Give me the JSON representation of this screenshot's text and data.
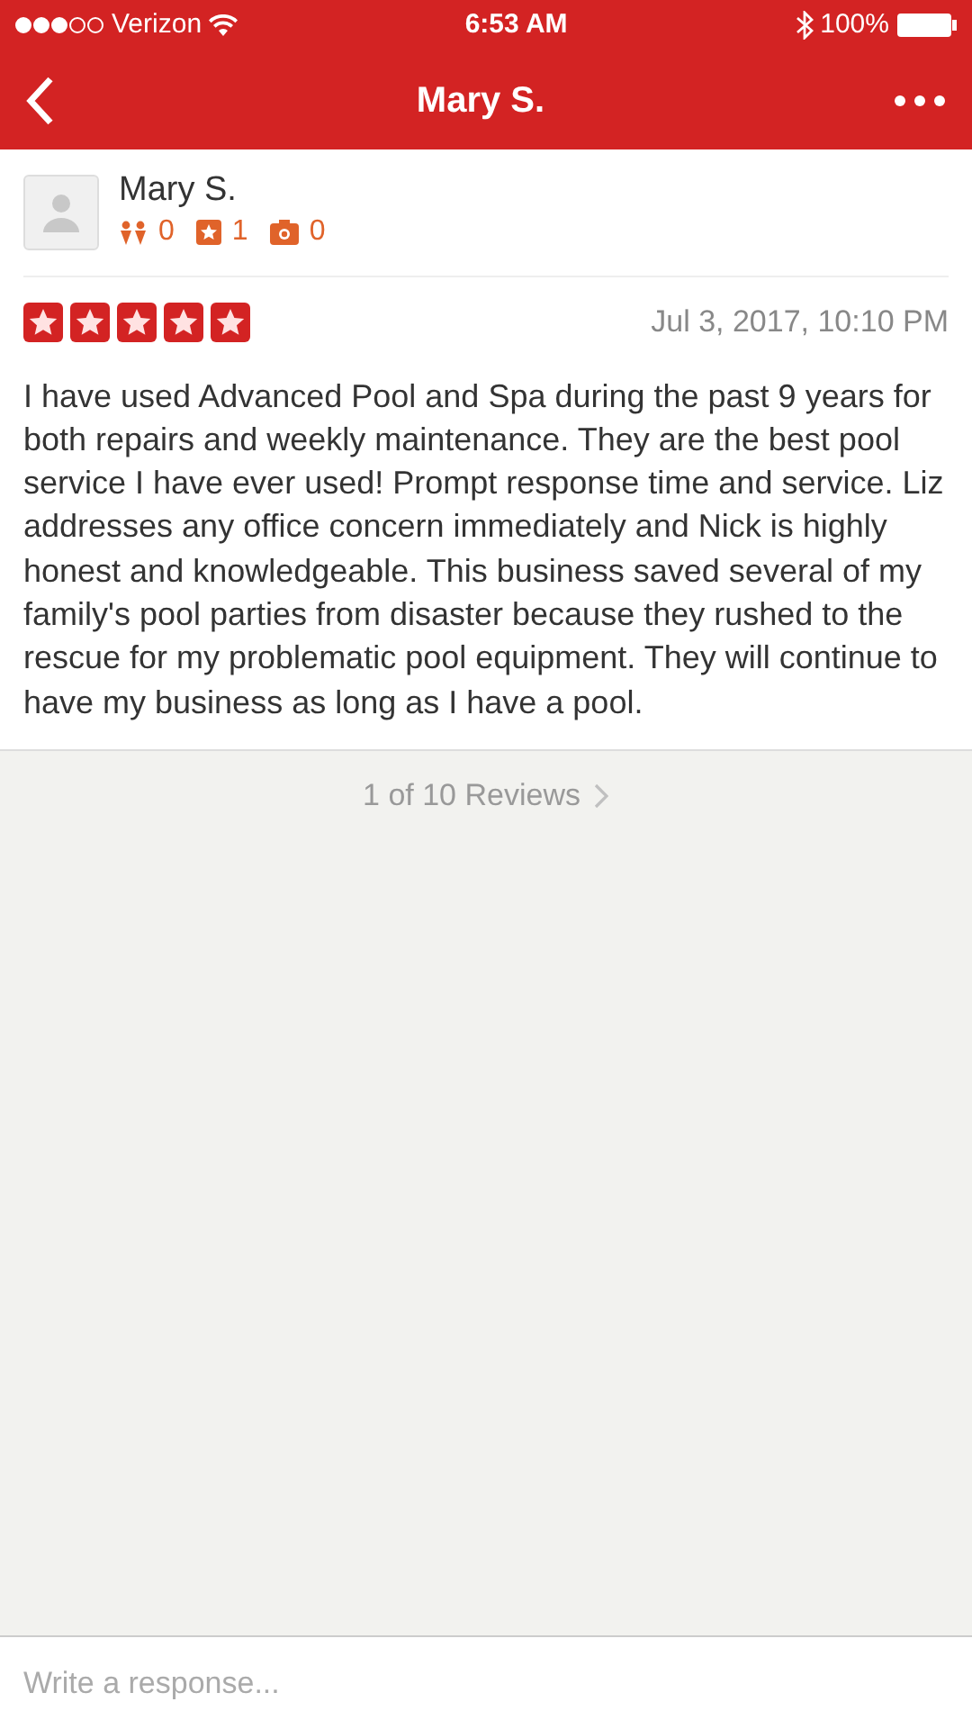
{
  "status_bar": {
    "carrier": "Verizon",
    "time": "6:53 AM",
    "battery": "100%"
  },
  "nav": {
    "title": "Mary S."
  },
  "reviewer": {
    "name": "Mary S.",
    "friends": "0",
    "reviews": "1",
    "photos": "0"
  },
  "review": {
    "stars": 5,
    "date": "Jul 3, 2017, 10:10 PM",
    "text": "I have used Advanced Pool and Spa during the past 9 years for both repairs and weekly maintenance. They are the best pool service I have ever used! Prompt response time and service. Liz addresses any office concern immediately and Nick is highly honest and knowledgeable. This business saved several of my family's pool parties from disaster because they rushed to the rescue for my problematic pool equipment. They will continue to have my business as long as I have a pool."
  },
  "pager": {
    "label": "1 of 10 Reviews"
  },
  "response": {
    "placeholder": "Write a response..."
  }
}
